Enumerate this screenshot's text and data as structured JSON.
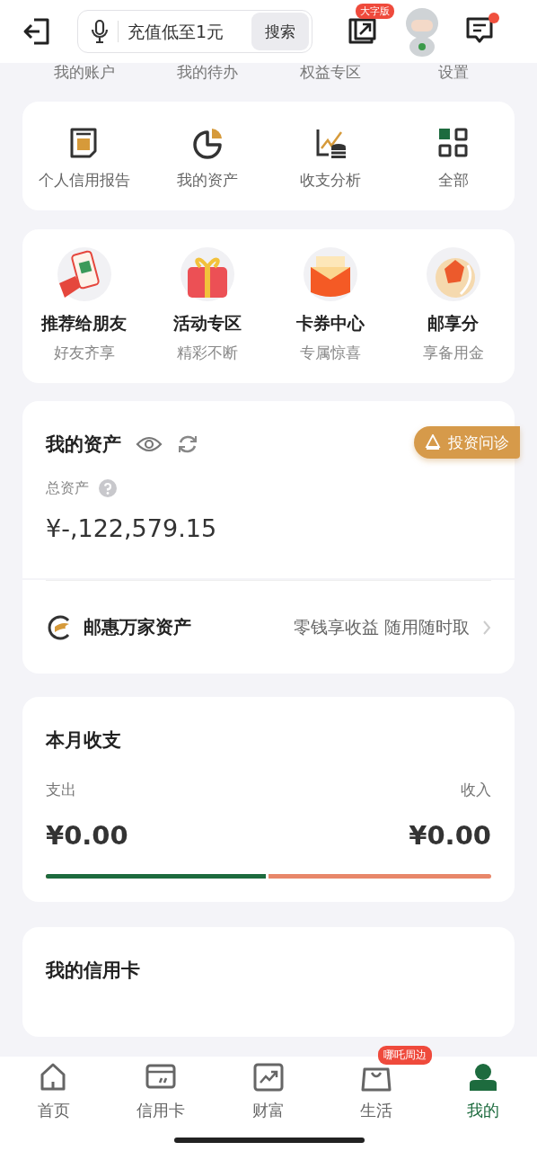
{
  "header": {
    "search": {
      "placeholder": "充值低至1元",
      "button": "搜索"
    },
    "large_font_badge": "大字版",
    "messages": {
      "unread": true
    }
  },
  "quick_links": [
    "我的账户",
    "我的待办",
    "权益专区",
    "设置"
  ],
  "services": [
    {
      "kind": "report",
      "label": "个人信用报告"
    },
    {
      "kind": "pie",
      "label": "我的资产"
    },
    {
      "kind": "analysis",
      "label": "收支分析"
    },
    {
      "kind": "grid",
      "label": "全部"
    }
  ],
  "promos": [
    {
      "kind": "phone",
      "title": "推荐给朋友",
      "subtitle": "好友齐享"
    },
    {
      "kind": "gift",
      "title": "活动专区",
      "subtitle": "精彩不断"
    },
    {
      "kind": "envelope",
      "title": "卡券中心",
      "subtitle": "专属惊喜"
    },
    {
      "kind": "gem",
      "title": "邮享分",
      "subtitle": "享备用金"
    }
  ],
  "assets": {
    "title": "我的资产",
    "diagnose_button": "投资问诊",
    "total_label": "总资产",
    "total_value": "¥-,122,579.15",
    "product": {
      "name": "邮惠万家资产",
      "slogan": "零钱享收益 随用随时取"
    }
  },
  "monthly": {
    "title": "本月收支",
    "expense_label": "支出",
    "income_label": "收入",
    "expense": "¥0.00",
    "income": "¥0.00",
    "level": 0.5
  },
  "credit_card": {
    "title": "我的信用卡"
  },
  "tabs": [
    {
      "kind": "home",
      "label": "首页",
      "selected": false
    },
    {
      "kind": "card",
      "label": "信用卡",
      "selected": false
    },
    {
      "kind": "wealth",
      "label": "财富",
      "selected": false
    },
    {
      "kind": "bag",
      "label": "生活",
      "selected": false,
      "badge": "哪吒周边"
    },
    {
      "kind": "person",
      "label": "我的",
      "selected": true
    }
  ]
}
